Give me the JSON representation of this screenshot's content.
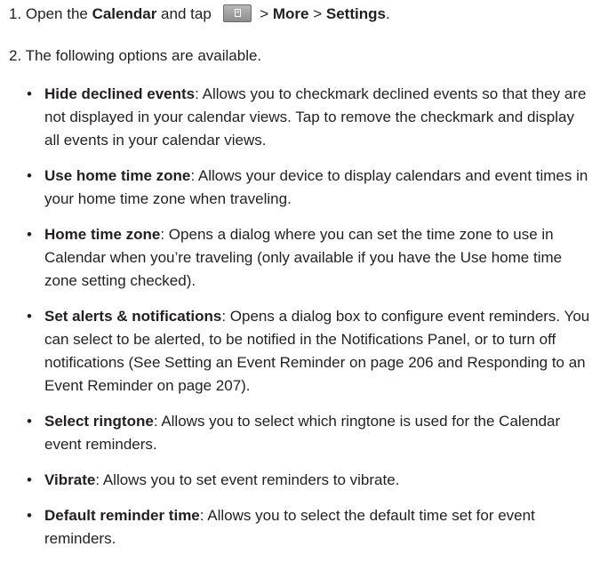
{
  "steps": {
    "s1": {
      "num": "1. ",
      "t1": "Open the ",
      "calendar": "Calendar",
      "t2": " and tap ",
      "sep1": " > ",
      "more": "More",
      "sep2": " > ",
      "settings": "Settings",
      "t3": ".",
      "icon": "menu-key-icon"
    },
    "s2": "2. The following options are available."
  },
  "options": [
    {
      "name": "Hide declined events",
      "desc": ": Allows you to checkmark declined events so that they are not displayed in your calendar views. Tap to remove the checkmark and display all events in your calendar views."
    },
    {
      "name": "Use home time zone",
      "desc": ": Allows your device to display calendars and event times in your home time zone when traveling."
    },
    {
      "name": "Home time zone",
      "desc": ": Opens a dialog where you can set the time zone to use in Calendar when you’re traveling (only available if you have the Use home time zone setting checked)."
    },
    {
      "name": "Set alerts & notifications",
      "desc": ": Opens a dialog box to configure event reminders. You can select to be alerted, to be notified in the Notifications Panel, or to turn off notifications (See Setting an Event Reminder on page 206 and Responding to an Event Reminder on page 207)."
    },
    {
      "name": "Select ringtone",
      "desc": ": Allows you to select which ringtone is used for the Calendar event reminders."
    },
    {
      "name": "Vibrate",
      "desc": ": Allows you to set event reminders to vibrate."
    },
    {
      "name": "Default reminder time",
      "desc": ": Allows you to select the default time set for event reminders."
    }
  ],
  "bullet": "•"
}
